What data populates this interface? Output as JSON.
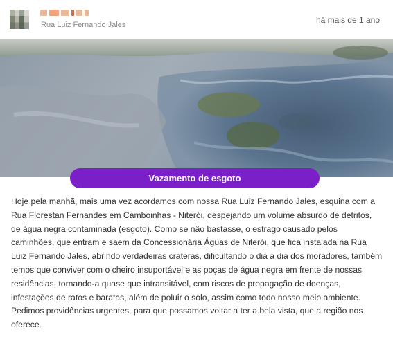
{
  "post": {
    "address": "Rua Luiz Fernando Jales",
    "timestamp": "há mais de 1 ano",
    "category": "Vazamento de esgoto",
    "description": "Hoje pela manhã, mais uma vez acordamos com nossa Rua Luiz Fernando Jales, esquina com a Rua Florestan Fernandes em Camboinhas - Niterói, despejando um volume absurdo de detritos, de água negra contaminada (esgoto). Como se não bastasse, o estrago causado pelos caminhões, que entram e saem da Concessionária Águas de Niterói, que fica instalada na Rua Luiz Fernando Jales, abrindo verdadeiras crateras, dificultando o dia a dia dos moradores, também temos que conviver com o cheiro insuportável e as poças de água negra em frente de nossas residências, tornando-a quase que intransitável, com riscos de propagação de doenças, infestações de ratos e baratas, além de poluir o solo, assim como todo nosso meio ambiente. Pedimos providências urgentes, para que possamos voltar a ter a bela vista, que a região nos oferece."
  },
  "colors": {
    "badge": "#7b1fc9"
  }
}
